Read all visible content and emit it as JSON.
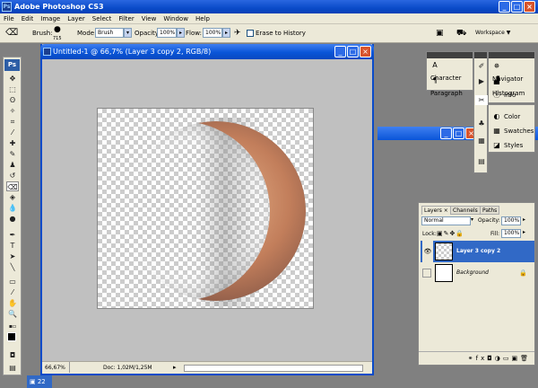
{
  "app": {
    "title": "Adobe Photoshop CS3",
    "logo": "Ps"
  },
  "menu": [
    "File",
    "Edit",
    "Image",
    "Layer",
    "Select",
    "Filter",
    "View",
    "Window",
    "Help"
  ],
  "options": {
    "brush_label": "Brush:",
    "brush_size": "715",
    "mode_label": "Mode:",
    "mode_value": "Brush",
    "opacity_label": "Opacity:",
    "opacity_value": "100%",
    "flow_label": "Flow:",
    "flow_value": "100%",
    "erase_history": "Erase to History",
    "workspace": "Workspace ▼"
  },
  "document": {
    "title": "Untitled-1 @ 66,7% (Layer 3 copy 2, RGB/8)",
    "zoom": "66,67%",
    "doc_info": "Doc: 1,02M/1,25M"
  },
  "panels": {
    "group1": [
      "Character",
      "Paragraph"
    ],
    "group2": [
      "Navigator",
      "Histogram",
      "Info"
    ],
    "group3": [
      "Color",
      "Swatches",
      "Styles"
    ]
  },
  "layers": {
    "tabs": [
      "Layers ×",
      "Channels",
      "Paths"
    ],
    "blend_mode": "Normal",
    "opacity_label": "Opacity:",
    "opacity_value": "100%",
    "lock_label": "Lock:",
    "fill_label": "Fill:",
    "fill_value": "100%",
    "rows": [
      {
        "name": "Layer 3 copy 2",
        "selected": true
      },
      {
        "name": "Background",
        "selected": false
      }
    ]
  },
  "taskbar": {
    "item": "22"
  },
  "colors": {
    "accent": "#3169c6",
    "ui_bg": "#ece9d8",
    "titlebar": "#0a4bc9"
  }
}
